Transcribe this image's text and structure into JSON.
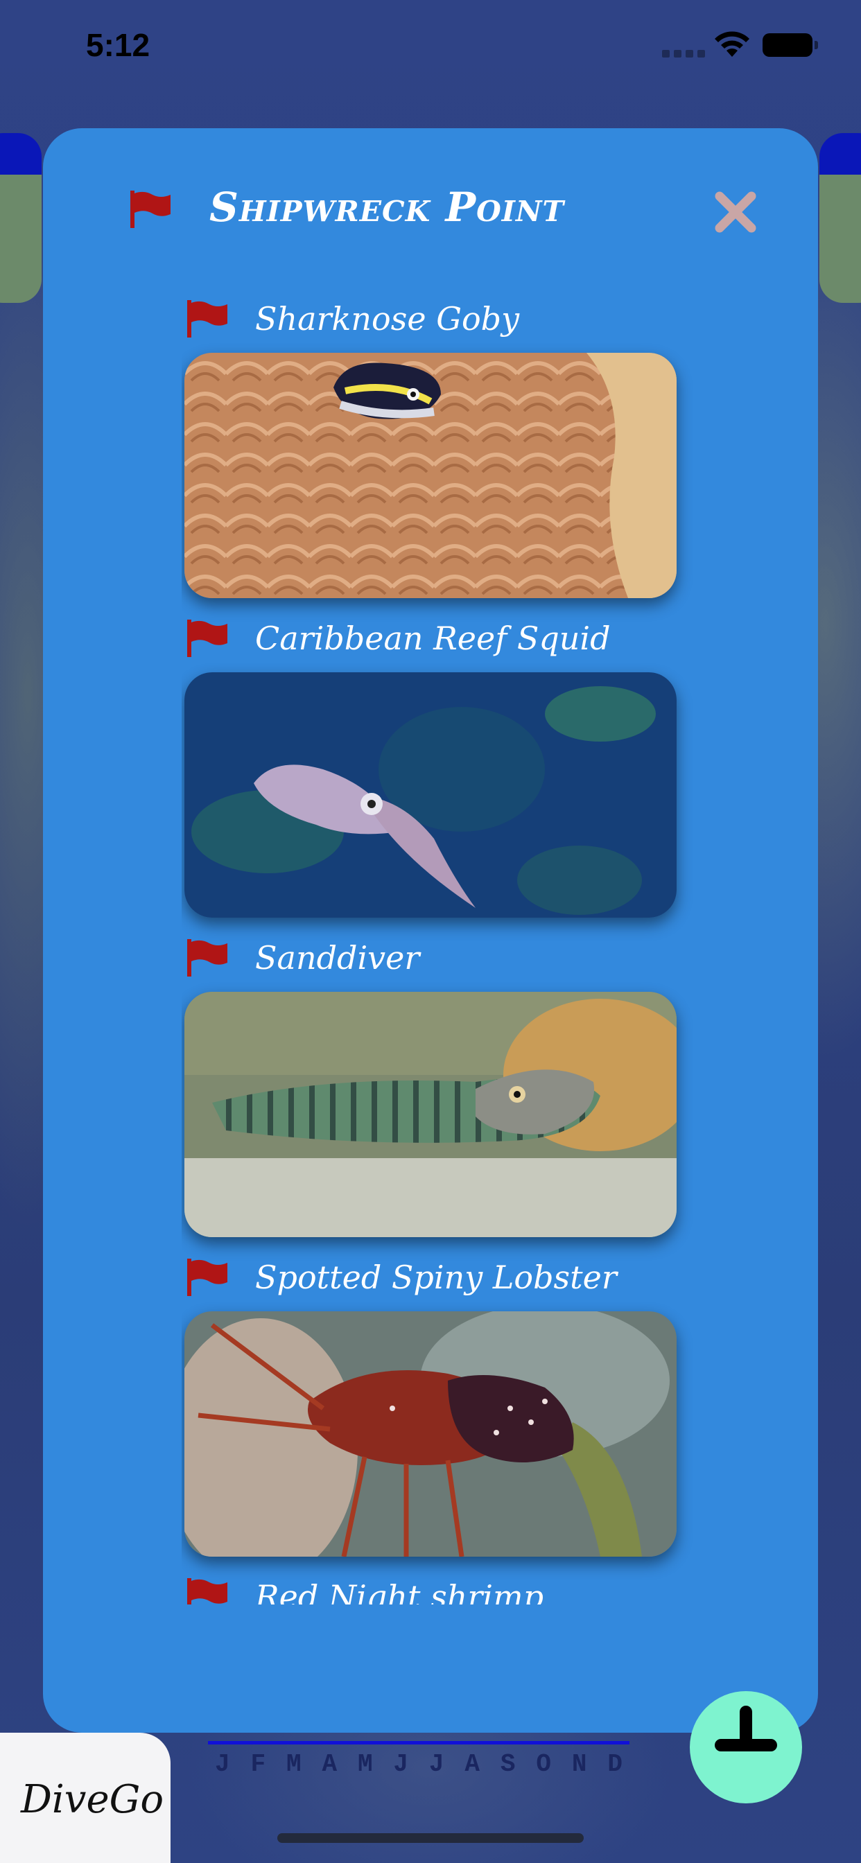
{
  "status_bar": {
    "time": "5:12",
    "icons": [
      "cellular-signal-icon",
      "wifi-icon",
      "battery-icon"
    ]
  },
  "modal": {
    "title": "Shipwreck Point",
    "title_icon": "red-flag-icon",
    "close_icon": "close-x-icon",
    "background_color": "#3389dd",
    "species": [
      {
        "name": "Sharknose Goby",
        "icon": "red-flag-icon",
        "photo": "sharknose-goby-photo"
      },
      {
        "name": "Caribbean Reef Squid",
        "icon": "red-flag-icon",
        "photo": "caribbean-reef-squid-photo"
      },
      {
        "name": "Sanddiver",
        "icon": "red-flag-icon",
        "photo": "sanddiver-photo"
      },
      {
        "name": "Spotted Spiny Lobster",
        "icon": "red-flag-icon",
        "photo": "spotted-spiny-lobster-photo"
      },
      {
        "name": "Red Night shrimp",
        "icon": "red-flag-icon",
        "photo": "red-night-shrimp-photo"
      }
    ]
  },
  "month_filter": {
    "months": [
      "J",
      "F",
      "M",
      "A",
      "M",
      "J",
      "J",
      "A",
      "S",
      "O",
      "N",
      "D"
    ],
    "accent_color": "#1010d8"
  },
  "brand": {
    "label": "DiveGo"
  },
  "add_button": {
    "icon": "plus-icon",
    "color": "#7ef3cf"
  },
  "colors": {
    "flag_red": "#b01515",
    "close_gray": "#c9a6a6"
  }
}
